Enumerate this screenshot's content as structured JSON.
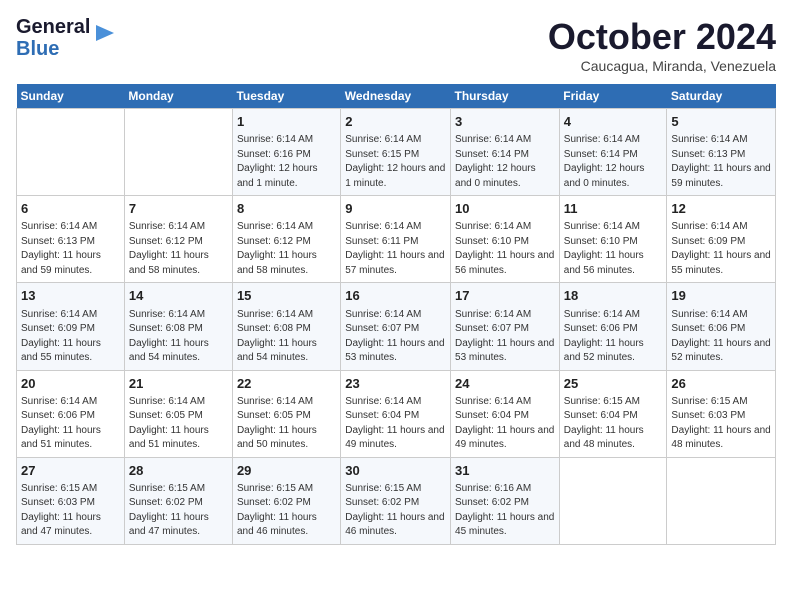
{
  "header": {
    "logo_line1": "General",
    "logo_line2": "Blue",
    "month": "October 2024",
    "location": "Caucagua, Miranda, Venezuela"
  },
  "days_of_week": [
    "Sunday",
    "Monday",
    "Tuesday",
    "Wednesday",
    "Thursday",
    "Friday",
    "Saturday"
  ],
  "weeks": [
    [
      {
        "day": "",
        "sunrise": "",
        "sunset": "",
        "daylight": ""
      },
      {
        "day": "",
        "sunrise": "",
        "sunset": "",
        "daylight": ""
      },
      {
        "day": "1",
        "sunrise": "Sunrise: 6:14 AM",
        "sunset": "Sunset: 6:16 PM",
        "daylight": "Daylight: 12 hours and 1 minute."
      },
      {
        "day": "2",
        "sunrise": "Sunrise: 6:14 AM",
        "sunset": "Sunset: 6:15 PM",
        "daylight": "Daylight: 12 hours and 1 minute."
      },
      {
        "day": "3",
        "sunrise": "Sunrise: 6:14 AM",
        "sunset": "Sunset: 6:14 PM",
        "daylight": "Daylight: 12 hours and 0 minutes."
      },
      {
        "day": "4",
        "sunrise": "Sunrise: 6:14 AM",
        "sunset": "Sunset: 6:14 PM",
        "daylight": "Daylight: 12 hours and 0 minutes."
      },
      {
        "day": "5",
        "sunrise": "Sunrise: 6:14 AM",
        "sunset": "Sunset: 6:13 PM",
        "daylight": "Daylight: 11 hours and 59 minutes."
      }
    ],
    [
      {
        "day": "6",
        "sunrise": "Sunrise: 6:14 AM",
        "sunset": "Sunset: 6:13 PM",
        "daylight": "Daylight: 11 hours and 59 minutes."
      },
      {
        "day": "7",
        "sunrise": "Sunrise: 6:14 AM",
        "sunset": "Sunset: 6:12 PM",
        "daylight": "Daylight: 11 hours and 58 minutes."
      },
      {
        "day": "8",
        "sunrise": "Sunrise: 6:14 AM",
        "sunset": "Sunset: 6:12 PM",
        "daylight": "Daylight: 11 hours and 58 minutes."
      },
      {
        "day": "9",
        "sunrise": "Sunrise: 6:14 AM",
        "sunset": "Sunset: 6:11 PM",
        "daylight": "Daylight: 11 hours and 57 minutes."
      },
      {
        "day": "10",
        "sunrise": "Sunrise: 6:14 AM",
        "sunset": "Sunset: 6:10 PM",
        "daylight": "Daylight: 11 hours and 56 minutes."
      },
      {
        "day": "11",
        "sunrise": "Sunrise: 6:14 AM",
        "sunset": "Sunset: 6:10 PM",
        "daylight": "Daylight: 11 hours and 56 minutes."
      },
      {
        "day": "12",
        "sunrise": "Sunrise: 6:14 AM",
        "sunset": "Sunset: 6:09 PM",
        "daylight": "Daylight: 11 hours and 55 minutes."
      }
    ],
    [
      {
        "day": "13",
        "sunrise": "Sunrise: 6:14 AM",
        "sunset": "Sunset: 6:09 PM",
        "daylight": "Daylight: 11 hours and 55 minutes."
      },
      {
        "day": "14",
        "sunrise": "Sunrise: 6:14 AM",
        "sunset": "Sunset: 6:08 PM",
        "daylight": "Daylight: 11 hours and 54 minutes."
      },
      {
        "day": "15",
        "sunrise": "Sunrise: 6:14 AM",
        "sunset": "Sunset: 6:08 PM",
        "daylight": "Daylight: 11 hours and 54 minutes."
      },
      {
        "day": "16",
        "sunrise": "Sunrise: 6:14 AM",
        "sunset": "Sunset: 6:07 PM",
        "daylight": "Daylight: 11 hours and 53 minutes."
      },
      {
        "day": "17",
        "sunrise": "Sunrise: 6:14 AM",
        "sunset": "Sunset: 6:07 PM",
        "daylight": "Daylight: 11 hours and 53 minutes."
      },
      {
        "day": "18",
        "sunrise": "Sunrise: 6:14 AM",
        "sunset": "Sunset: 6:06 PM",
        "daylight": "Daylight: 11 hours and 52 minutes."
      },
      {
        "day": "19",
        "sunrise": "Sunrise: 6:14 AM",
        "sunset": "Sunset: 6:06 PM",
        "daylight": "Daylight: 11 hours and 52 minutes."
      }
    ],
    [
      {
        "day": "20",
        "sunrise": "Sunrise: 6:14 AM",
        "sunset": "Sunset: 6:06 PM",
        "daylight": "Daylight: 11 hours and 51 minutes."
      },
      {
        "day": "21",
        "sunrise": "Sunrise: 6:14 AM",
        "sunset": "Sunset: 6:05 PM",
        "daylight": "Daylight: 11 hours and 51 minutes."
      },
      {
        "day": "22",
        "sunrise": "Sunrise: 6:14 AM",
        "sunset": "Sunset: 6:05 PM",
        "daylight": "Daylight: 11 hours and 50 minutes."
      },
      {
        "day": "23",
        "sunrise": "Sunrise: 6:14 AM",
        "sunset": "Sunset: 6:04 PM",
        "daylight": "Daylight: 11 hours and 49 minutes."
      },
      {
        "day": "24",
        "sunrise": "Sunrise: 6:14 AM",
        "sunset": "Sunset: 6:04 PM",
        "daylight": "Daylight: 11 hours and 49 minutes."
      },
      {
        "day": "25",
        "sunrise": "Sunrise: 6:15 AM",
        "sunset": "Sunset: 6:04 PM",
        "daylight": "Daylight: 11 hours and 48 minutes."
      },
      {
        "day": "26",
        "sunrise": "Sunrise: 6:15 AM",
        "sunset": "Sunset: 6:03 PM",
        "daylight": "Daylight: 11 hours and 48 minutes."
      }
    ],
    [
      {
        "day": "27",
        "sunrise": "Sunrise: 6:15 AM",
        "sunset": "Sunset: 6:03 PM",
        "daylight": "Daylight: 11 hours and 47 minutes."
      },
      {
        "day": "28",
        "sunrise": "Sunrise: 6:15 AM",
        "sunset": "Sunset: 6:02 PM",
        "daylight": "Daylight: 11 hours and 47 minutes."
      },
      {
        "day": "29",
        "sunrise": "Sunrise: 6:15 AM",
        "sunset": "Sunset: 6:02 PM",
        "daylight": "Daylight: 11 hours and 46 minutes."
      },
      {
        "day": "30",
        "sunrise": "Sunrise: 6:15 AM",
        "sunset": "Sunset: 6:02 PM",
        "daylight": "Daylight: 11 hours and 46 minutes."
      },
      {
        "day": "31",
        "sunrise": "Sunrise: 6:16 AM",
        "sunset": "Sunset: 6:02 PM",
        "daylight": "Daylight: 11 hours and 45 minutes."
      },
      {
        "day": "",
        "sunrise": "",
        "sunset": "",
        "daylight": ""
      },
      {
        "day": "",
        "sunrise": "",
        "sunset": "",
        "daylight": ""
      }
    ]
  ]
}
